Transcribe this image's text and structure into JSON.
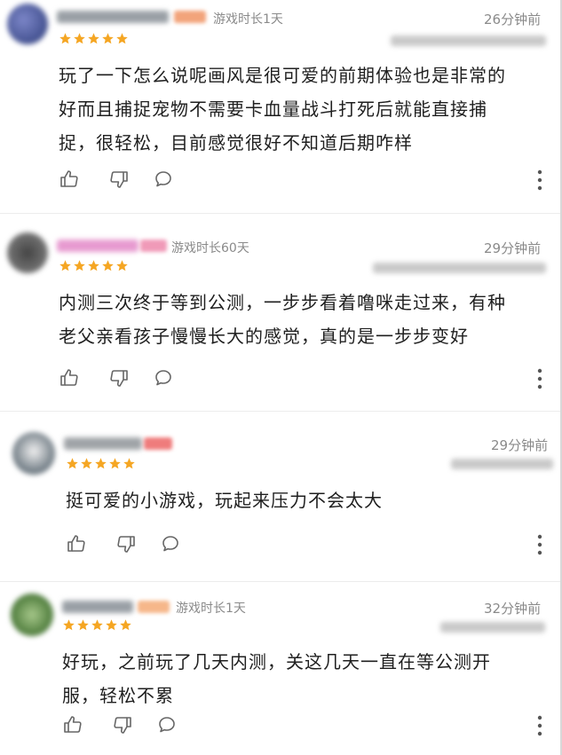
{
  "colors": {
    "star": "#f5a623",
    "meta": "#8a8a8a",
    "text": "#1f1f1f",
    "icon": "#666666"
  },
  "reviews": [
    {
      "playtime": "游戏时长1天",
      "time": "26分钟前",
      "stars": 5,
      "lines": [
        "玩了一下怎么说呢画风是很可爱的前期体验也是非常的",
        "好而且捕捉宠物不需要卡血量战斗打死后就能直接捕",
        "捉，很轻松，目前感觉很好不知道后期咋样"
      ]
    },
    {
      "playtime": "游戏时长60天",
      "time": "29分钟前",
      "stars": 5,
      "lines": [
        "内测三次终于等到公测，一步步看着噜咪走过来，有种",
        "老父亲看孩子慢慢长大的感觉，真的是一步步变好"
      ]
    },
    {
      "playtime": "",
      "time": "29分钟前",
      "stars": 5,
      "lines": [
        "挺可爱的小游戏，玩起来压力不会太大"
      ]
    },
    {
      "playtime": "游戏时长1天",
      "time": "32分钟前",
      "stars": 5,
      "lines": [
        "好玩，之前玩了几天内测，关这几天一直在等公测开",
        "服，轻松不累"
      ]
    }
  ],
  "icons": {
    "like": "thumbs-up-icon",
    "dislike": "thumbs-down-icon",
    "reply": "comment-icon",
    "more": "more-vertical-icon"
  }
}
